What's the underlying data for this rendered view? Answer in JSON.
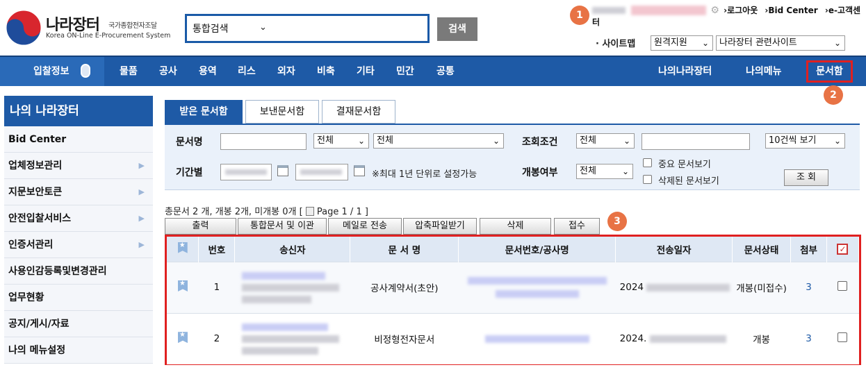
{
  "header": {
    "logo_title": "나라장터",
    "logo_sub": "국가종합전자조달",
    "logo_eng": "Korea ON-Line E-Procurement System",
    "search_scope": "통합검색",
    "search_button": "검색",
    "util": {
      "logout": "›로그아웃",
      "bid_center": "›Bid Center",
      "customer": "›e-고객센터"
    },
    "sitemap": "· 사이트맵",
    "remote_support": "원격지원",
    "related_sites": "나라장터 관련사이트"
  },
  "annotations": [
    "1",
    "2",
    "3"
  ],
  "nav": {
    "items": [
      "입찰정보",
      "물품",
      "공사",
      "용역",
      "리스",
      "외자",
      "비축",
      "기타",
      "민간",
      "공통"
    ],
    "right": [
      "나의나라장터",
      "나의메뉴",
      "문서함"
    ]
  },
  "sidebar": {
    "title": "나의 나라장터",
    "items": [
      {
        "label": "Bid Center",
        "arrow": ""
      },
      {
        "label": "업체정보관리",
        "arrow": "▶"
      },
      {
        "label": "지문보안토큰",
        "arrow": "▶"
      },
      {
        "label": "안전입찰서비스",
        "arrow": "▶"
      },
      {
        "label": "인증서관리",
        "arrow": "▶"
      },
      {
        "label": "사용인감등록및변경관리",
        "arrow": ""
      },
      {
        "label": "업무현황",
        "arrow": ""
      },
      {
        "label": "공지/게시/자료",
        "arrow": ""
      },
      {
        "label": "나의 메뉴설정",
        "arrow": ""
      }
    ]
  },
  "tabs": [
    "받은 문서함",
    "보낸문서함",
    "결재문서함"
  ],
  "filter": {
    "doc_name_label": "문서명",
    "all1": "전체",
    "all2": "전체",
    "query_label": "조회조건",
    "all3": "전체",
    "page_size": "10건씩 보기",
    "period_label": "기간별",
    "period_note": "※최대 1년 단위로 설정가능",
    "open_label": "개봉여부",
    "all4": "전체",
    "important": "중요 문서보기",
    "deleted": "삭제된 문서보기",
    "search_button": "조 회"
  },
  "summary": "총문서 2 개, 개봉 2개, 미개봉 0개 [ ",
  "summary_page": "Page 1 / 1 ]",
  "actions": [
    "출력",
    "통합문서 및 이관",
    "메일로 전송",
    "압축파일받기",
    "삭제",
    "접수"
  ],
  "table": {
    "headers": [
      "번호",
      "송신자",
      "문 서 명",
      "문서번호/공사명",
      "전송일자",
      "문서상태",
      "첨부"
    ],
    "rows": [
      {
        "no": "1",
        "title": "공사계약서(초안)",
        "date": "2024",
        "status": "개봉(미접수)",
        "attach": "3"
      },
      {
        "no": "2",
        "title": "비정형전자문서",
        "date": "2024.",
        "status": "개봉",
        "attach": "3"
      }
    ]
  },
  "colors": {
    "brand": "#1e5aa6",
    "highlight": "#e02020",
    "badge": "#e87345"
  },
  "icons": [
    "taegeuk-logo-icon",
    "chevron-down-icon",
    "gear-icon",
    "mouse-icon",
    "calendar-icon",
    "page-icon",
    "bookmark-star-icon",
    "checkbox-icon"
  ]
}
